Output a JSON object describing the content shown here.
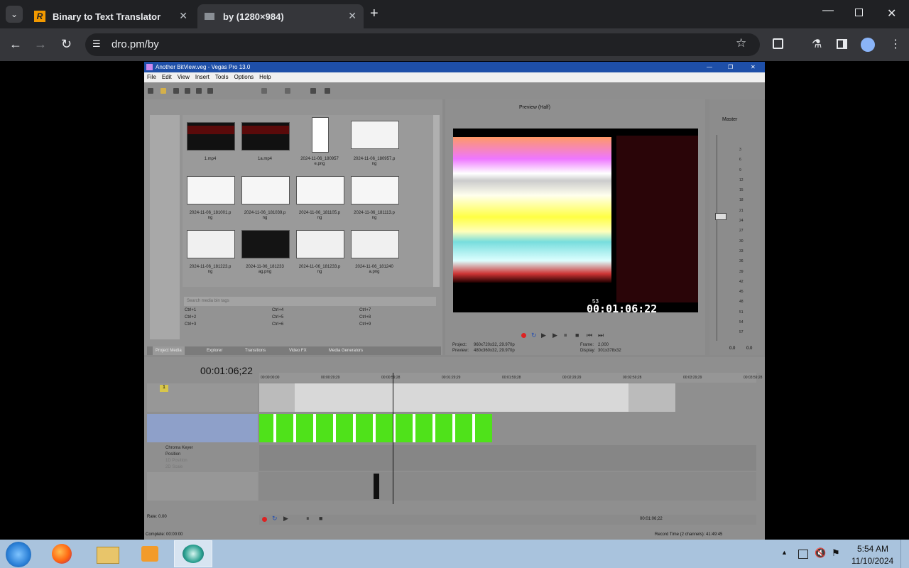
{
  "browser": {
    "tabs": [
      {
        "title": "Binary to Text Translator",
        "icon_letter": "R",
        "active": false
      },
      {
        "title": "by (1280×984)",
        "active": true
      }
    ],
    "url": "dro.pm/by"
  },
  "vegas": {
    "title": "Another BitView.veg - Vegas Pro 13.0",
    "menu": [
      "File",
      "Edit",
      "View",
      "Insert",
      "Tools",
      "Options",
      "Help"
    ],
    "media_items": [
      {
        "name": "1.mp4"
      },
      {
        "name": "1a.mp4"
      },
      {
        "name": "2024-11-06_180957\ne.png"
      },
      {
        "name": "2024-11-06_180957.p\nng"
      },
      {
        "name": "2024-11-06_181001.p\nng"
      },
      {
        "name": "2024-11-06_181039.p\nng"
      },
      {
        "name": "2024-11-06_181105.p\nng"
      },
      {
        "name": "2024-11-06_181113.p\nng"
      },
      {
        "name": "2024-11-06_181223.p\nng"
      },
      {
        "name": "2024-11-06_181233\nag.png"
      },
      {
        "name": "2024-11-06_181233.p\nng"
      },
      {
        "name": "2024-11-06_181240\na.png"
      }
    ],
    "search_placeholder": "Search media bin tags",
    "shortcuts": [
      "Ctrl+1",
      "Ctrl+4",
      "Ctrl+7",
      "Ctrl+2",
      "Ctrl+5",
      "Ctrl+8",
      "Ctrl+3",
      "Ctrl+6",
      "Ctrl+9"
    ],
    "bottom_tabs": [
      "Project Media",
      "Explorer",
      "Transitions",
      "Video FX",
      "Media Generators"
    ],
    "preview": {
      "mode": "Preview (Half)",
      "timecode": "00:01:06;22",
      "project_label": "Project:",
      "project_value": "960x720x32, 29.970p",
      "preview_label": "Preview:",
      "preview_value": "480x360x32, 29.970p",
      "frame_label": "Frame:",
      "frame_value": "2,000",
      "display_label": "Display:",
      "display_value": "301x378x32",
      "yt_number": "53"
    },
    "mixer": {
      "title": "Master",
      "scale": [
        "3",
        "6",
        "9",
        "12",
        "15",
        "18",
        "21",
        "24",
        "27",
        "30",
        "33",
        "36",
        "39",
        "42",
        "45",
        "48",
        "51",
        "54",
        "57"
      ],
      "bottom": [
        "0.0",
        "0.0"
      ]
    },
    "timeline": {
      "cursor": "00:01:06;22",
      "ruler": [
        "00:00:00;00",
        "00:00:29;29",
        "00:00:59;28",
        "00:01:29;29",
        "00:01:59;28",
        "00:02:29;29",
        "00:02:59;28",
        "00:03:29;29",
        "00:03:59;28"
      ],
      "track1_number": "1",
      "fx_lines": [
        "Chroma Keyer",
        "Position",
        "1D Position",
        "2D Scale"
      ],
      "rate": "Rate: 0.00",
      "complete": "Complete: 00:00:00",
      "end_timecode": "00:01:06;22",
      "record_time": "Record Time (2 channels): 41:49:45"
    }
  },
  "taskbar": {
    "time": "5:54 AM",
    "date": "11/10/2024"
  }
}
